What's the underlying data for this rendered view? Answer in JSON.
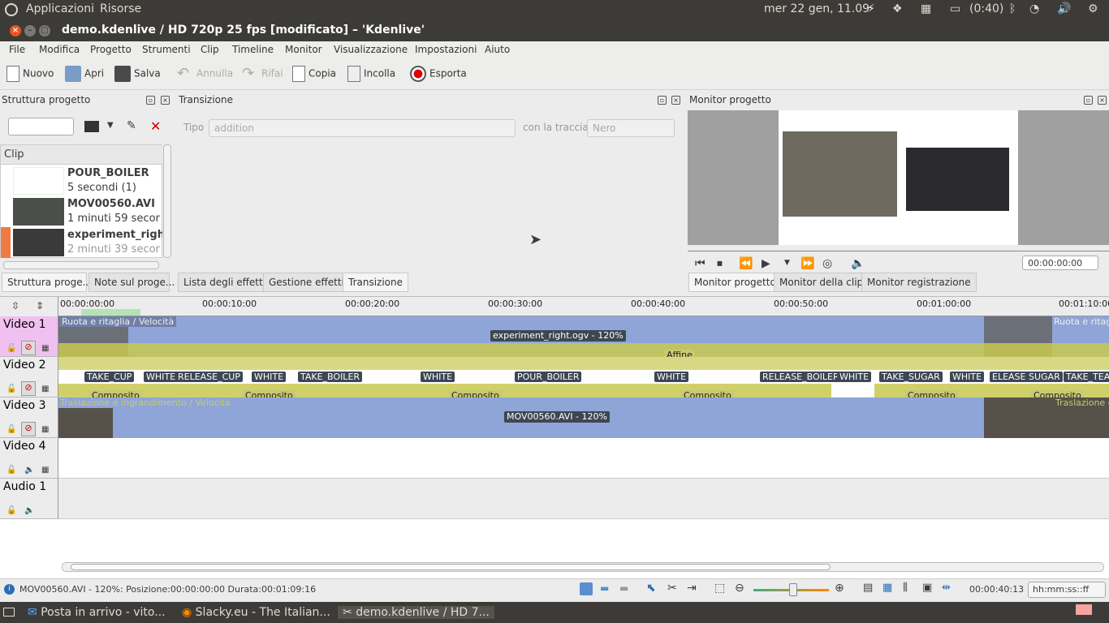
{
  "topbar": {
    "apps": "Applicazioni",
    "resources": "Risorse",
    "datetime": "mer 22 gen, 11.09",
    "battery": "(0:40)"
  },
  "window": {
    "title": "demo.kdenlive / HD 720p 25 fps [modificato] – 'Kdenlive'"
  },
  "menu": [
    "File",
    "Modifica",
    "Progetto",
    "Strumenti",
    "Clip",
    "Timeline",
    "Monitor",
    "Visualizzazione",
    "Impostazioni",
    "Aiuto"
  ],
  "toolbar": {
    "new": "Nuovo",
    "open": "Apri",
    "save": "Salva",
    "undo": "Annulla",
    "redo": "Rifai",
    "copy": "Copia",
    "paste": "Incolla",
    "export": "Esporta"
  },
  "project_tree": {
    "title": "Struttura progetto",
    "column": "Clip",
    "clips": [
      {
        "name": "POUR_BOILER",
        "info": "5 secondi (1)"
      },
      {
        "name": "MOV00560.AVI",
        "info": "1 minuti 59 secon"
      },
      {
        "name": "experiment_righ",
        "info": "2 minuti 39 secon"
      }
    ]
  },
  "transition": {
    "title": "Transizione",
    "type_label": "Tipo",
    "type_value": "addition",
    "track_label": "con la traccia",
    "track_value": "Nero"
  },
  "monitor": {
    "title": "Monitor progetto",
    "timecode": "00:00:00:00"
  },
  "left_tabs": [
    "Struttura proge...",
    "Note sul proge..."
  ],
  "mid_tabs": [
    "Lista degli effetti",
    "Gestione effetti",
    "Transizione"
  ],
  "monitor_tabs": [
    "Monitor progetto",
    "Monitor della clip",
    "Monitor registrazione"
  ],
  "ruler": [
    "00:00:00:00",
    "00:00:10:00",
    "00:00:20:00",
    "00:00:30:00",
    "00:00:40:00",
    "00:00:50:00",
    "00:01:00:00",
    "00:01:10:00"
  ],
  "tracks": [
    "Video 1",
    "Video 2",
    "Video 3",
    "Video 4",
    "Audio 1"
  ],
  "timeline": {
    "v1_effect": "Ruota e ritaglia / Velocità",
    "v1_effect2": "Ruota e ritag",
    "v1_clip": "experiment_right.ogv - 120%",
    "affine": "Affine",
    "v2_clips": [
      "TAKE_CUP",
      "WHITE",
      "RELEASE_CUP",
      "WHITE",
      "TAKE_BOILER",
      "WHITE",
      "POUR_BOILER",
      "WHITE",
      "RELEASE_BOILER",
      "WHITE",
      "TAKE_SUGAR",
      "WHITE",
      "ELEASE SUGAR",
      "TAKE_TEA"
    ],
    "composite": "Composito",
    "v3_effect": "Traslazione e ingrandimento / Velocità",
    "v3_effect2": "Traslazione e",
    "v3_clip": "MOV00560.AVI - 120%"
  },
  "status": {
    "message": "MOV00560.AVI - 120%: Posizione:00:00:00:00 Durata:00:01:09:16",
    "time": "00:00:40:13",
    "format": "hh:mm:ss::ff"
  },
  "taskbar": [
    "Posta in arrivo - vito...",
    "Slacky.eu - The Italian...",
    "demo.kdenlive / HD 7..."
  ]
}
